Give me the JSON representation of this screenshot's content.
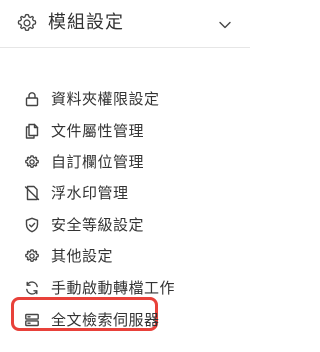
{
  "header": {
    "title": "模組設定",
    "icon": "gear-icon",
    "toggle_icon": "chevron-down-icon"
  },
  "menu": {
    "items": [
      {
        "label": "資料夾權限設定",
        "icon": "lock-icon"
      },
      {
        "label": "文件屬性管理",
        "icon": "document-copy-icon"
      },
      {
        "label": "自訂欄位管理",
        "icon": "gear-icon"
      },
      {
        "label": "浮水印管理",
        "icon": "watermark-off-icon"
      },
      {
        "label": "安全等級設定",
        "icon": "shield-icon"
      },
      {
        "label": "其他設定",
        "icon": "gear-icon"
      },
      {
        "label": "手動啟動轉檔工作",
        "icon": "refresh-icon"
      },
      {
        "label": "全文檢索伺服器",
        "icon": "server-icon",
        "highlighted": true
      }
    ]
  },
  "colors": {
    "highlight_border": "#e8413a",
    "text": "#333333",
    "divider": "#e6e6e6"
  }
}
